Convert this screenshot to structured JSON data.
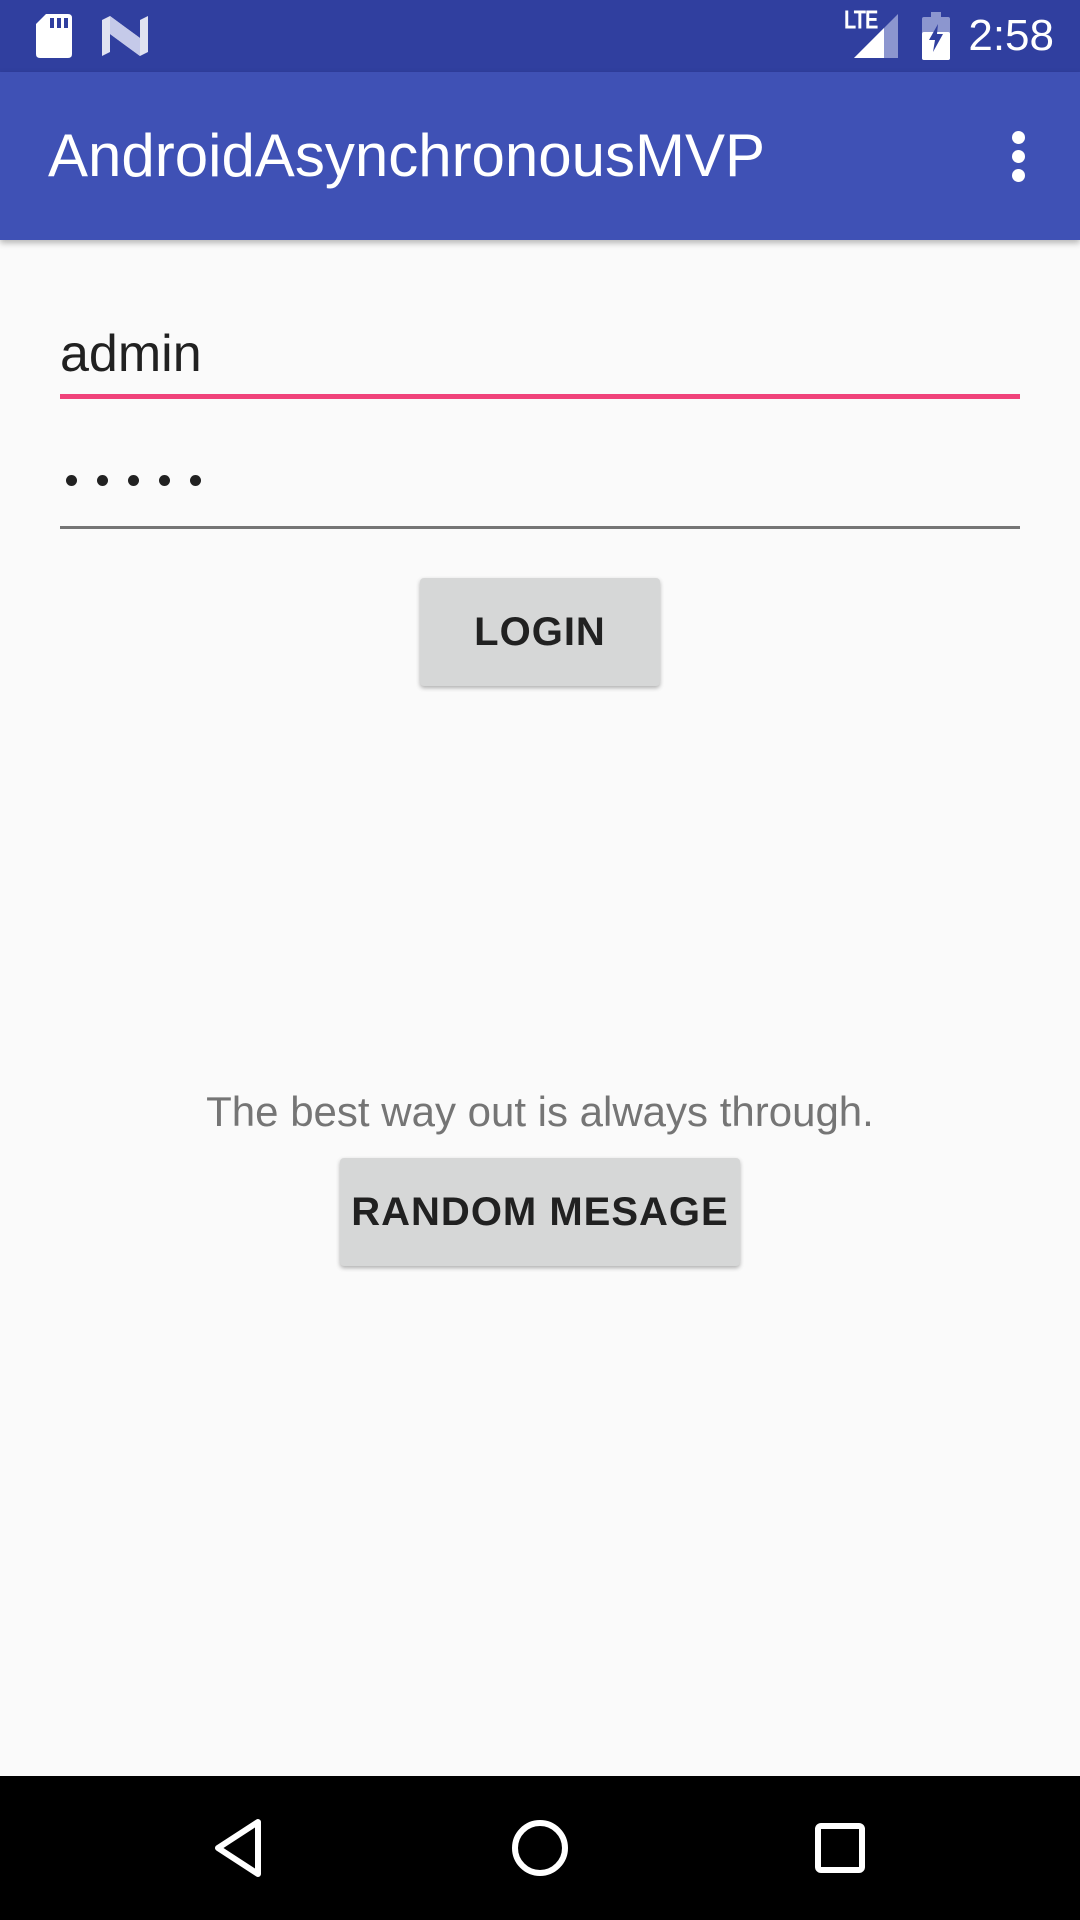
{
  "status_bar": {
    "time": "2:58",
    "network": "LTE",
    "icons": [
      "sd-card-icon",
      "n-logo-icon",
      "lte-signal-icon",
      "battery-charging-icon"
    ]
  },
  "app_bar": {
    "title": "AndroidAsynchronousMVP",
    "menu_icon": "overflow-menu-icon"
  },
  "login_form": {
    "username_value": "admin",
    "password_masked_length": 5,
    "login_label": "LOGIN"
  },
  "message": {
    "text": "The best way out is always through.",
    "button_label": "RANDOM MESAGE"
  },
  "nav_bar": {
    "icons": [
      "back-icon",
      "home-icon",
      "recents-icon"
    ]
  },
  "colors": {
    "status_bar": "#303f9f",
    "app_bar": "#3f51b5",
    "accent": "#f0427a",
    "background": "#fafafa",
    "button": "#d6d7d7"
  }
}
